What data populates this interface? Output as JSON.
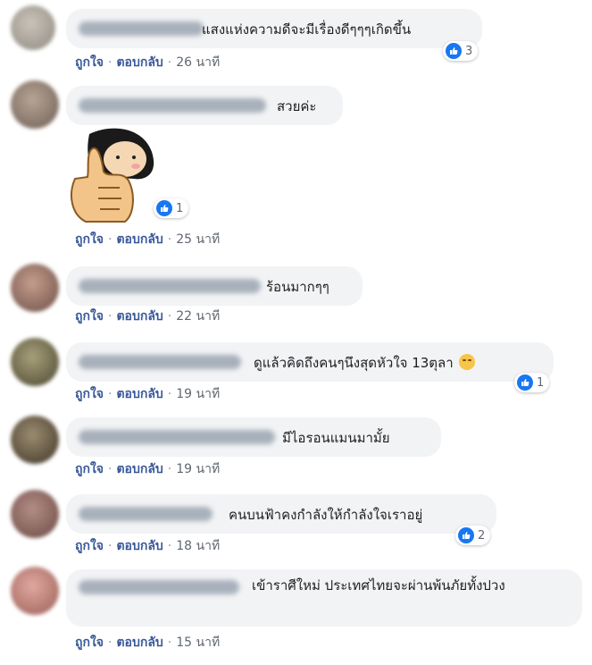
{
  "actions": {
    "like": "ถูกใจ",
    "reply": "ตอบกลับ",
    "dot": "·"
  },
  "comments": [
    {
      "text": "แสงแห่งความดีจะมีเรื่องดีๆๆๆเกิดขึ้น",
      "time": "26 นาที",
      "reactions": "3",
      "reaction_icon": "like-icon"
    },
    {
      "text": "สวยค่ะ",
      "sticker": "thumbs-up-girl-sticker",
      "time": "25 นาที",
      "reactions": "1",
      "reaction_icon": "like-icon"
    },
    {
      "text": "ร้อนมากๆๆ",
      "time": "22 นาที"
    },
    {
      "text": "ดูแล้วคิดถึงคนๆนึงสุดหัวใจ 13ตุลา",
      "emoji": "sad-face-emoji",
      "time": "19 นาที",
      "reactions": "1",
      "reaction_icon": "like-icon"
    },
    {
      "text": "มีไอรอนแมนมามั้ย",
      "time": "19 นาที"
    },
    {
      "text": "คนบนฟ้าคงกำลังให้กำลังใจเราอยู่",
      "time": "18 นาที",
      "reactions": "2",
      "reaction_icon": "like-icon"
    },
    {
      "text": "เข้าราศีใหม่ ประเทศไทยจะผ่านพ้นภัยทั้งปวง",
      "time": "15 นาที"
    }
  ],
  "colors": {
    "bubble": "#f2f3f5",
    "action_link": "#385898",
    "like_blue": "#1877f2"
  }
}
